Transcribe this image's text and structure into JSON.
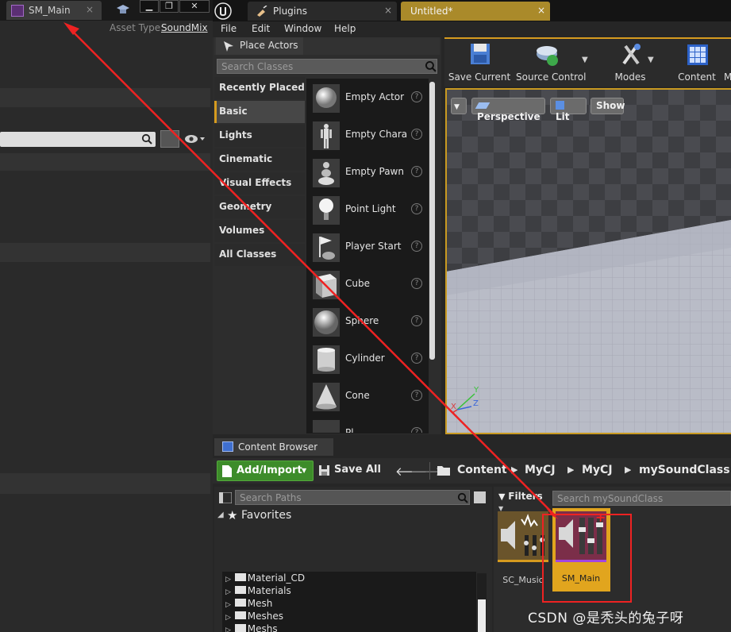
{
  "left_editor": {
    "tab_title": "SM_Main",
    "tab_close": "×",
    "window_controls": {
      "minimize": "▁",
      "restore": "❐",
      "close": "✕"
    },
    "asset_type_label": "Asset Type:",
    "asset_type_value": "SoundMix"
  },
  "ue": {
    "tabs": [
      {
        "label": "Plugins",
        "close": "×"
      },
      {
        "label": "Untitled*",
        "close": "×"
      }
    ],
    "menu": [
      "File",
      "Edit",
      "Window",
      "Help"
    ]
  },
  "place_actors": {
    "title": "Place Actors",
    "search_placeholder": "Search Classes",
    "categories": [
      "Recently Placed",
      "Basic",
      "Lights",
      "Cinematic",
      "Visual Effects",
      "Geometry",
      "Volumes",
      "All Classes"
    ],
    "active_category": "Basic",
    "items": [
      {
        "label": "Empty Actor",
        "icon": "empty-actor-icon"
      },
      {
        "label": "Empty Character",
        "icon": "empty-character-icon"
      },
      {
        "label": "Empty Pawn",
        "icon": "empty-pawn-icon"
      },
      {
        "label": "Point Light",
        "icon": "point-light-icon"
      },
      {
        "label": "Player Start",
        "icon": "player-start-icon"
      },
      {
        "label": "Cube",
        "icon": "cube-icon"
      },
      {
        "label": "Sphere",
        "icon": "sphere-icon"
      },
      {
        "label": "Cylinder",
        "icon": "cylinder-icon"
      },
      {
        "label": "Cone",
        "icon": "cone-icon"
      },
      {
        "label": "Pl",
        "icon": "plane-icon"
      }
    ],
    "help_glyph": "?"
  },
  "toolbar": {
    "items": [
      {
        "label": "Save Current",
        "icon": "save-icon"
      },
      {
        "label": "Source Control",
        "icon": "source-control-icon"
      },
      {
        "label": "Modes",
        "icon": "modes-icon"
      },
      {
        "label": "Content",
        "icon": "content-icon"
      },
      {
        "label": "M",
        "icon": "marketplace-icon"
      }
    ]
  },
  "viewport": {
    "perspective": "Perspective",
    "lit": "Lit",
    "show": "Show",
    "axis_y": "Y",
    "axis_z": "Z",
    "axis_x": "X"
  },
  "content_browser": {
    "title": "Content Browser",
    "add_import": "Add/Import",
    "save_all": "Save All",
    "breadcrumb": [
      "Content",
      "MyCJ",
      "MyCJ",
      "mySoundClass"
    ],
    "search_paths_placeholder": "Search Paths",
    "favorites": "Favorites",
    "folders": [
      "Material_CD",
      "Materials",
      "Mesh",
      "Meshes",
      "Meshs"
    ],
    "filters": "Filters",
    "assets_search_placeholder": "Search mySoundClass",
    "assets": [
      {
        "label": "SC_Music",
        "type": "sound-class"
      },
      {
        "label": "SM_Main",
        "type": "sound-mix",
        "selected": true
      }
    ]
  },
  "watermark": "CSDN @是秃头的兔子呀",
  "colors": {
    "accent": "#d69b1f",
    "annotation_red": "#ee2222",
    "add_import_green": "#3d8c2a"
  }
}
